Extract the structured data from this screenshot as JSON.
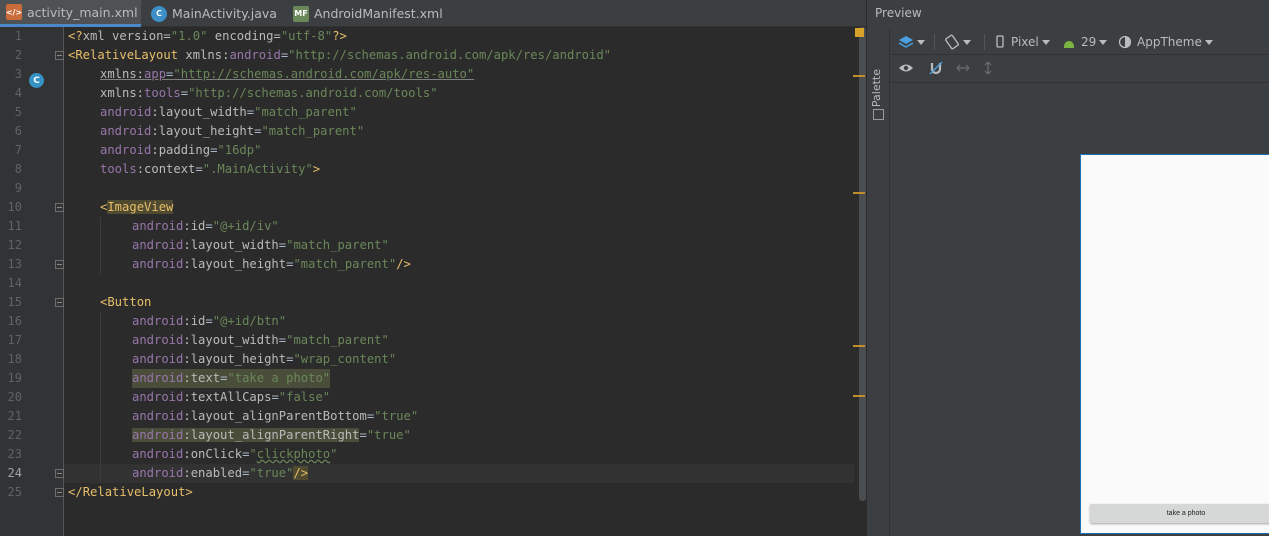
{
  "tabs": [
    {
      "label": "activity_main.xml",
      "icon": "xml-file-icon",
      "active": true
    },
    {
      "label": "MainActivity.java",
      "icon": "java-class-icon",
      "active": false
    },
    {
      "label": "AndroidManifest.xml",
      "icon": "manifest-file-icon",
      "active": false
    }
  ],
  "editor": {
    "current_line": 24,
    "line_numbers": [
      "1",
      "2",
      "3",
      "4",
      "5",
      "6",
      "7",
      "8",
      "9",
      "10",
      "11",
      "12",
      "13",
      "14",
      "15",
      "16",
      "17",
      "18",
      "19",
      "20",
      "21",
      "22",
      "23",
      "24",
      "25"
    ],
    "code": {
      "l1": {
        "open": "<?",
        "tag": "xml",
        "a1": " version=",
        "v1": "\"1.0\"",
        "a2": " encoding=",
        "v2": "\"utf-8\"",
        "close": "?>"
      },
      "l2": {
        "lt": "<",
        "tag": "RelativeLayout",
        "ns": " xmlns:",
        "nsname": "android",
        "eq": "=",
        "val": "\"http://schemas.android.com/apk/res/android\""
      },
      "l3": {
        "ns": "xmlns:",
        "attr": "app",
        "eq": "=",
        "val": "\"http://schemas.android.com/apk/res-auto\""
      },
      "l4": {
        "ns": "xmlns:",
        "attr": "tools",
        "eq": "=",
        "val": "\"http://schemas.android.com/tools\""
      },
      "l5": {
        "ns": "android",
        "attr": ":layout_width",
        "eq": "=",
        "val": "\"match_parent\""
      },
      "l6": {
        "ns": "android",
        "attr": ":layout_height",
        "eq": "=",
        "val": "\"match_parent\""
      },
      "l7": {
        "ns": "android",
        "attr": ":padding",
        "eq": "=",
        "val": "\"16dp\""
      },
      "l8": {
        "ns": "tools",
        "attr": ":context",
        "eq": "=",
        "val": "\".MainActivity\"",
        "close": ">"
      },
      "l10": {
        "lt": "<",
        "tag": "ImageView"
      },
      "l11": {
        "ns": "android",
        "attr": ":id",
        "eq": "=",
        "val": "\"@+id/iv\""
      },
      "l12": {
        "ns": "android",
        "attr": ":layout_width",
        "eq": "=",
        "val": "\"match_parent\""
      },
      "l13": {
        "ns": "android",
        "attr": ":layout_height",
        "eq": "=",
        "val": "\"match_parent\"",
        "close": "/>"
      },
      "l15": {
        "lt": "<",
        "tag": "Button"
      },
      "l16": {
        "ns": "android",
        "attr": ":id",
        "eq": "=",
        "val": "\"@+id/btn\""
      },
      "l17": {
        "ns": "android",
        "attr": ":layout_width",
        "eq": "=",
        "val": "\"match_parent\""
      },
      "l18": {
        "ns": "android",
        "attr": ":layout_height",
        "eq": "=",
        "val": "\"wrap_content\""
      },
      "l19": {
        "ns": "android",
        "attr": ":text",
        "eq": "=",
        "val": "\"take a photo\""
      },
      "l20": {
        "ns": "android",
        "attr": ":textAllCaps",
        "eq": "=",
        "val": "\"false\""
      },
      "l21": {
        "ns": "android",
        "attr": ":layout_alignParentBottom",
        "eq": "=",
        "val": "\"true\""
      },
      "l22": {
        "ns": "android",
        "attr": ":layout_alignParentRight",
        "eq": "=",
        "val": "\"true\""
      },
      "l23": {
        "ns": "android",
        "attr": ":onClick",
        "eq": "=",
        "q1": "\"",
        "val": "clickphoto",
        "q2": "\""
      },
      "l24": {
        "ns": "android",
        "attr": ":enabled",
        "eq": "=",
        "val": "\"true\"",
        "close": "/>"
      },
      "l25": {
        "lt": "</",
        "tag": "RelativeLayout",
        "gt": ">"
      }
    }
  },
  "preview": {
    "title": "Preview",
    "palette_label": "Palette",
    "device": "Pixel",
    "api_level": "29",
    "theme": "AppTheme",
    "button_text": "take a photo"
  },
  "colors": {
    "tag": "#e8bf6a",
    "namespace": "#9876aa",
    "value": "#6a8759",
    "background": "#2b2b2b",
    "selection": "#1e6fb5"
  }
}
